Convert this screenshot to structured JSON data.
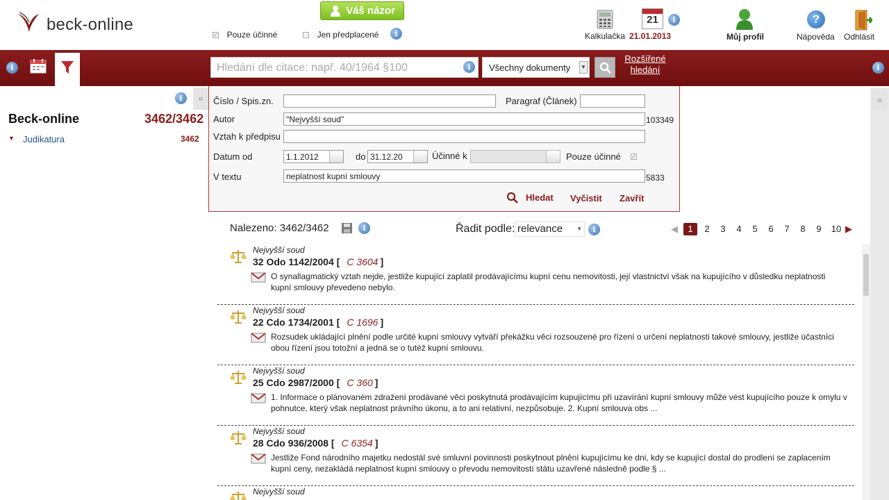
{
  "brand": {
    "name": "beck-online"
  },
  "header": {
    "opinion_button": "Váš názor",
    "only_effective": "Pouze účinné",
    "only_subscribed": "Jen předplacené",
    "calculator": "Kalkulačka",
    "date": "21.01.2013",
    "calendar_day": "21",
    "profile": "Můj profil",
    "help": "Nápověda",
    "logout": "Odhlásit"
  },
  "searchbar": {
    "placeholder": "Hledání dle citace: např. 40/1964 §100",
    "doc_type": "Všechny dokumenty",
    "advanced_line1": "Rozšířené",
    "advanced_line2": "hledání"
  },
  "sidebar": {
    "title": "Beck-online",
    "title_count": "3462/3462",
    "items": [
      {
        "label": "Judikatura",
        "count": "3462"
      }
    ]
  },
  "form": {
    "number_label": "Číslo / Spis.zn.",
    "number_value": "",
    "paragraph_label": "Paragraf (Článek)",
    "paragraph_value": "",
    "author_label": "Autor",
    "author_value": "\"Nejvyšší soud\"",
    "author_count": "103349",
    "relation_label": "Vztah k předpisu",
    "relation_value": "",
    "date_from_label": "Datum od",
    "date_from_value": "1.1.2012",
    "date_to_label": "do",
    "date_to_value": "31.12.20",
    "effective_to_label": "Účinné k",
    "effective_to_value": "",
    "only_effective_label": "Pouze účinné",
    "text_label": "V textu",
    "text_value": "neplatnost kupní smlouvy",
    "text_count": "5833",
    "search_btn": "Hledat",
    "clear_btn": "Vyčistit",
    "close_btn": "Zavřít"
  },
  "results": {
    "found_label": "Nalezeno: 3462/3462",
    "sort_label": "Řadit podle:",
    "sort_value": "relevance",
    "pages": [
      "1",
      "2",
      "3",
      "4",
      "5",
      "6",
      "7",
      "8",
      "9",
      "10"
    ],
    "current_page": "1",
    "items": [
      {
        "court": "Nejvyšší soud",
        "case": "32 Odo 1142/2004",
        "bracket_open": "[",
        "ref": "C 3604",
        "bracket_close": "]",
        "abstract": "O synallagmatický vztah nejde, jestliže kupující zaplatil prodávajícímu kupní cenu nemovitosti, její vlastnictví však na kupujícího v důsledku neplatnosti kupní smlouvy převedeno nebylo."
      },
      {
        "court": "Nejvyšší soud",
        "case": "22 Cdo 1734/2001",
        "bracket_open": "[",
        "ref": "C 1696",
        "bracket_close": "]",
        "abstract": "Rozsudek ukládající plnění podle určité kupní smlouvy vytváří překážku věci rozsouzené pro řízení o určení neplatnosti takové smlouvy, jestliže účastníci obou řízení jsou totožní a jedná se o tutéž kupní smlouvu."
      },
      {
        "court": "Nejvyšší soud",
        "case": "25 Cdo 2987/2000",
        "bracket_open": "[",
        "ref": "C 360",
        "bracket_close": "]",
        "abstract": "1. Informace o plánovaném zdražení prodávané věci poskytnutá prodávajícím kupujícímu při uzavírání kupní smlouvy může vést kupujícího pouze k omylu v pohnutce, který však neplatnost právního úkonu, a to ani relativní, nezpůsobuje. 2. Kupní smlouva obs ..."
      },
      {
        "court": "Nejvyšší soud",
        "case": "28 Cdo 936/2008",
        "bracket_open": "[",
        "ref": "C 6354",
        "bracket_close": "]",
        "abstract": "Jestliže Fond národního majetku nedostál své smluvní povinnosti poskytnout plnění kupujícímu ke dni, kdy se kupující dostal do prodlení se zaplacením kupní ceny, nezakládá neplatnost kupní smlouvy o převodu nemovitostí státu uzavřené následně podle § ..."
      },
      {
        "court": "Nejvyšší soud",
        "case": "",
        "bracket_open": "",
        "ref": "",
        "bracket_close": "",
        "abstract": ""
      }
    ]
  },
  "colors": {
    "brand_red": "#8a1c1c",
    "opinion_green": "#8cc63f",
    "info_blue": "#3f77b8"
  }
}
